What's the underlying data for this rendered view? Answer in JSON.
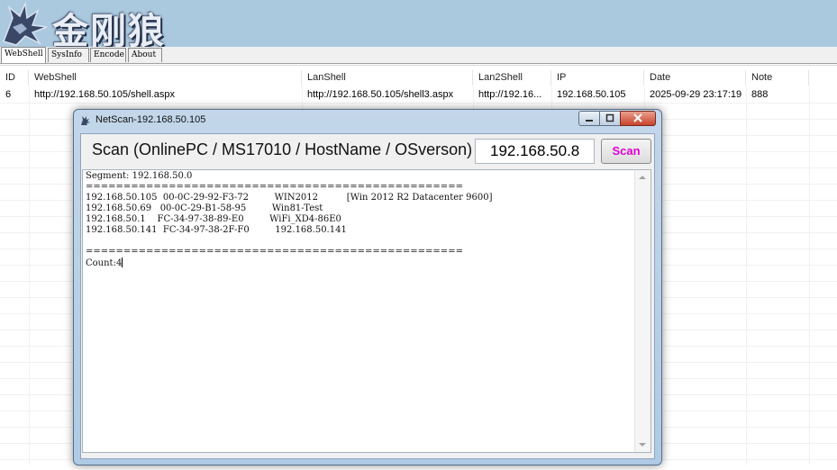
{
  "banner": {
    "logo_text": "金刚狼"
  },
  "tabs": [
    {
      "label": "WebShell",
      "active": true
    },
    {
      "label": "SysInfo",
      "active": false
    },
    {
      "label": "Encode",
      "active": false
    },
    {
      "label": "About",
      "active": false
    }
  ],
  "table": {
    "columns": [
      "ID",
      "WebShell",
      "LanShell",
      "Lan2Shell",
      "IP",
      "Date",
      "Note"
    ],
    "rows": [
      [
        "6",
        "http://192.168.50.105/shell.aspx",
        "http://192.168.50.105/shell3.aspx",
        "http://192.16...",
        "192.168.50.105",
        "2025-09-29 23:17:19",
        "888"
      ]
    ]
  },
  "dialog": {
    "title": "NetScan-192.168.50.105",
    "scan_label": "Scan (OnlinePC / MS17010 / HostName / OSverson)",
    "ip_value": "192.168.50.8",
    "scan_button": "Scan",
    "output": {
      "segment": "Segment: 192.168.50.0",
      "separator": "==================================================",
      "rows": [
        "192.168.50.105  00-0C-29-92-F3-72         WIN2012          [Win 2012 R2 Datacenter 9600]",
        "192.168.50.69   00-0C-29-B1-58-95         Win81-Test",
        "192.168.50.1    FC-34-97-38-89-E0         WiFi_XD4-86E0",
        "192.168.50.141  FC-34-97-38-2F-F0         192.168.50.141"
      ],
      "count": "Count:4"
    }
  },
  "colors": {
    "banner_bg": "#aac9df",
    "scan_button_text": "#e000d0",
    "title_bar": "#b8d0e8"
  }
}
